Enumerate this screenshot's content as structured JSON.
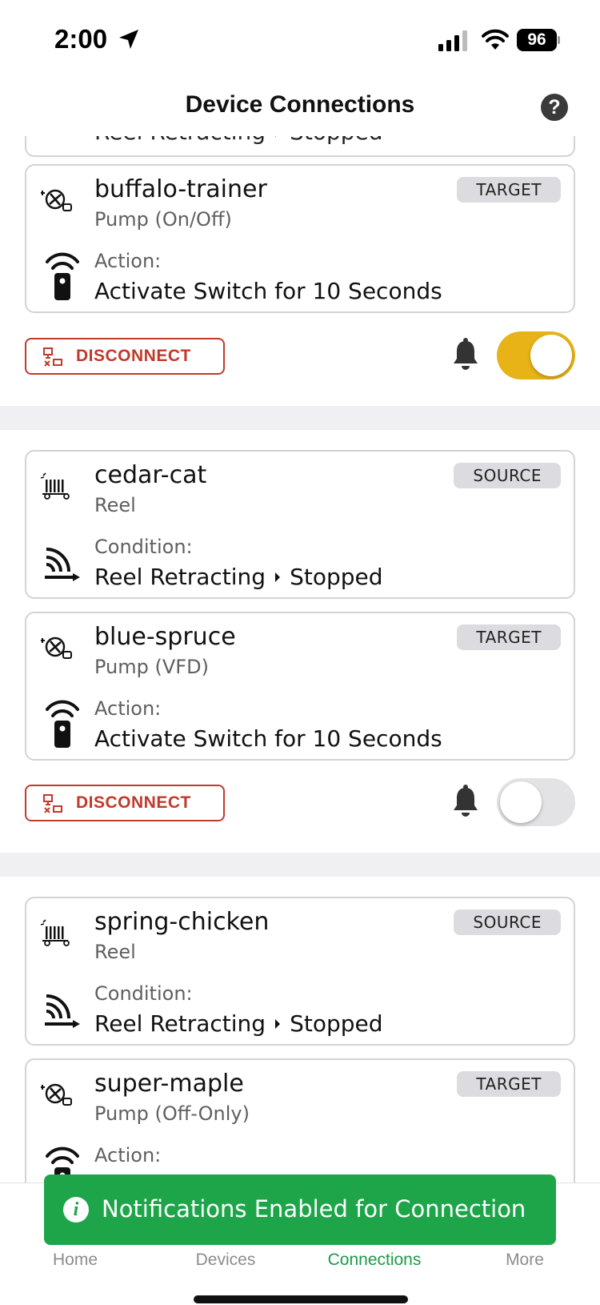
{
  "status_bar": {
    "time": "2:00",
    "battery": "96"
  },
  "header": {
    "title": "Device Connections",
    "help_glyph": "?"
  },
  "partial_card": {
    "condition_value": "Reel Retracting",
    "condition_state": "Stopped"
  },
  "connections": [
    {
      "target": {
        "name": "buffalo-trainer",
        "type": "Pump (On/Off)",
        "role": "TARGET",
        "action_label": "Action:",
        "action_value": "Activate Switch for 10 Seconds"
      },
      "disconnect_label": "DISCONNECT",
      "notifications_on": true
    },
    {
      "source": {
        "name": "cedar-cat",
        "type": "Reel",
        "role": "SOURCE",
        "condition_label": "Condition:",
        "condition_value": "Reel Retracting",
        "condition_state": "Stopped"
      },
      "target": {
        "name": "blue-spruce",
        "type": "Pump (VFD)",
        "role": "TARGET",
        "action_label": "Action:",
        "action_value": "Activate Switch for 10 Seconds"
      },
      "disconnect_label": "DISCONNECT",
      "notifications_on": false
    },
    {
      "source": {
        "name": "spring-chicken",
        "type": "Reel",
        "role": "SOURCE",
        "condition_label": "Condition:",
        "condition_value": "Reel Retracting",
        "condition_state": "Stopped"
      },
      "target": {
        "name": "super-maple",
        "type": "Pump (Off-Only)",
        "role": "TARGET",
        "action_label": "Action:"
      }
    }
  ],
  "tabs": [
    {
      "label": "Home",
      "active": false
    },
    {
      "label": "Devices",
      "active": false
    },
    {
      "label": "Connections",
      "active": true
    },
    {
      "label": "More",
      "active": false
    }
  ],
  "toast": {
    "message": "Notifications Enabled for Connection",
    "icon": "info-icon",
    "color": "#1ea54a"
  },
  "colors": {
    "accent": "#e7b316",
    "danger": "#c03a2b",
    "active_tab": "#1c9b47"
  }
}
